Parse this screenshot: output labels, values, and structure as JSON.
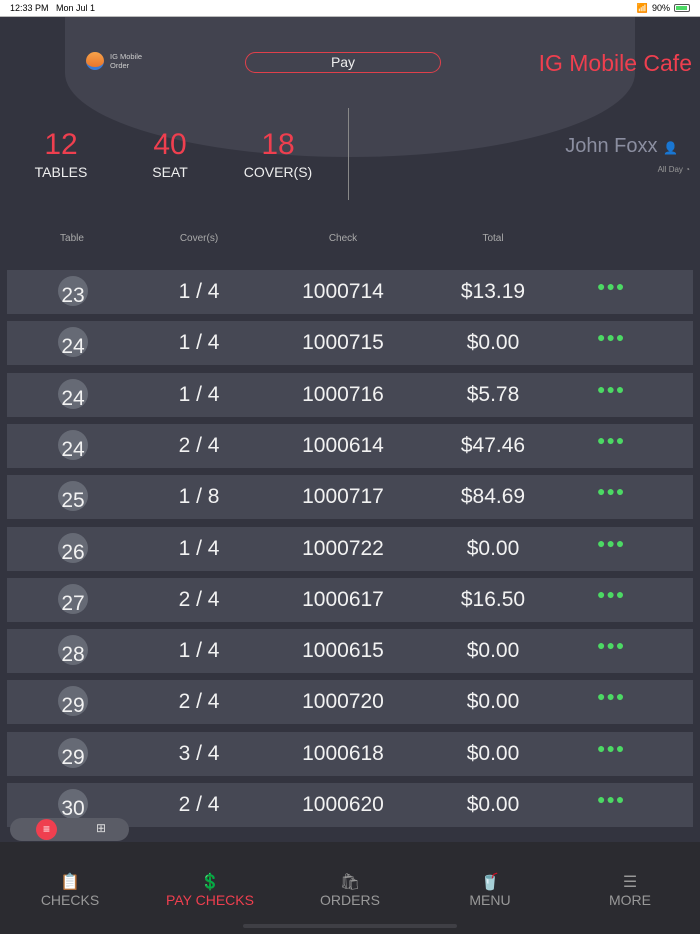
{
  "status_bar": {
    "time": "12:33 PM",
    "date": "Mon Jul 1",
    "battery": "90%"
  },
  "header": {
    "logo_line1": "IG Mobile",
    "logo_line2": "Order",
    "mode": "Pay",
    "cafe_name": "IG Mobile Cafe"
  },
  "stats": [
    {
      "value": "12",
      "label": "TABLES"
    },
    {
      "value": "40",
      "label": "SEAT"
    },
    {
      "value": "18",
      "label": "COVER(S)"
    }
  ],
  "user": {
    "name": "John Foxx",
    "period": "All Day"
  },
  "columns": [
    "Table",
    "Cover(s)",
    "Check",
    "Total"
  ],
  "rows": [
    {
      "table": "23",
      "covers": "1 / 4",
      "check": "1000714",
      "total": "$13.19"
    },
    {
      "table": "24",
      "covers": "1 / 4",
      "check": "1000715",
      "total": "$0.00"
    },
    {
      "table": "24",
      "covers": "1 / 4",
      "check": "1000716",
      "total": "$5.78"
    },
    {
      "table": "24",
      "covers": "2 / 4",
      "check": "1000614",
      "total": "$47.46"
    },
    {
      "table": "25",
      "covers": "1 / 8",
      "check": "1000717",
      "total": "$84.69"
    },
    {
      "table": "26",
      "covers": "1 / 4",
      "check": "1000722",
      "total": "$0.00"
    },
    {
      "table": "27",
      "covers": "2 / 4",
      "check": "1000617",
      "total": "$16.50"
    },
    {
      "table": "28",
      "covers": "1 / 4",
      "check": "1000615",
      "total": "$0.00"
    },
    {
      "table": "29",
      "covers": "2 / 4",
      "check": "1000720",
      "total": "$0.00"
    },
    {
      "table": "29",
      "covers": "3 / 4",
      "check": "1000618",
      "total": "$0.00"
    },
    {
      "table": "30",
      "covers": "2 / 4",
      "check": "1000620",
      "total": "$0.00"
    }
  ],
  "tabs": [
    {
      "label": "CHECKS",
      "icon": "📋"
    },
    {
      "label": "PAY CHECKS",
      "icon": "💲"
    },
    {
      "label": "ORDERS",
      "icon": "🛍"
    },
    {
      "label": "MENU",
      "icon": "🥤"
    },
    {
      "label": "MORE",
      "icon": "☰"
    }
  ],
  "active_tab": 1
}
